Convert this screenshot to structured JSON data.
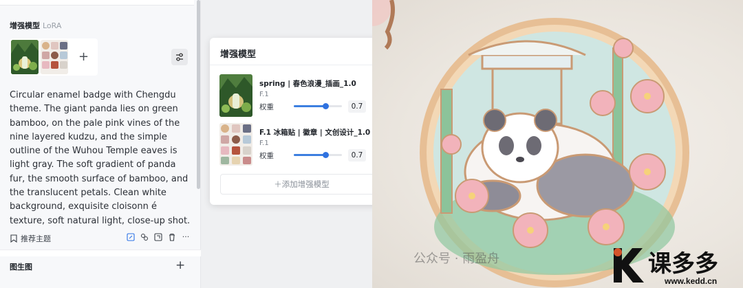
{
  "left_panel": {
    "section_title": "增强模型",
    "section_subtitle": "LoRA",
    "add_symbol": "+",
    "prompt_text": "Circular enamel badge with Chengdu theme. The giant panda lies on green bamboo, on the pale pink vines of the nine layered kudzu, and the simple outline of the Wuhou Temple eaves is light gray. The soft gradient of panda fur, the smooth surface of bamboo, and the translucent petals. Clean white background, exquisite cloisonn é texture, soft natural light, close-up shot.",
    "recommend_label": "推荐主题",
    "more_symbol": "···",
    "img2img_title": "图生图",
    "img2img_add": "+"
  },
  "dialog": {
    "title": "增强模型",
    "close_symbol": "✕",
    "models": [
      {
        "name": "spring | 春色浪漫_插画_1.0",
        "base": "F.1",
        "weight_label": "权重",
        "weight": "0.7",
        "minus": "—"
      },
      {
        "name": "F.1 冰箱贴 | 徽章 | 文创设计_1.0",
        "base": "F.1",
        "weight_label": "权重",
        "weight": "0.7",
        "minus": "—"
      }
    ],
    "add_button": "＋添加增强模型"
  },
  "watermark": {
    "text": "公众号 · 雨盈舟",
    "logo_text": "课多多",
    "logo_url": "www.kedd.cn"
  },
  "colors": {
    "accent": "#2f72e0",
    "badge_rim": "#e2b98c",
    "badge_fill": "#cfe6e2",
    "blossom": "#f2b3bb"
  }
}
